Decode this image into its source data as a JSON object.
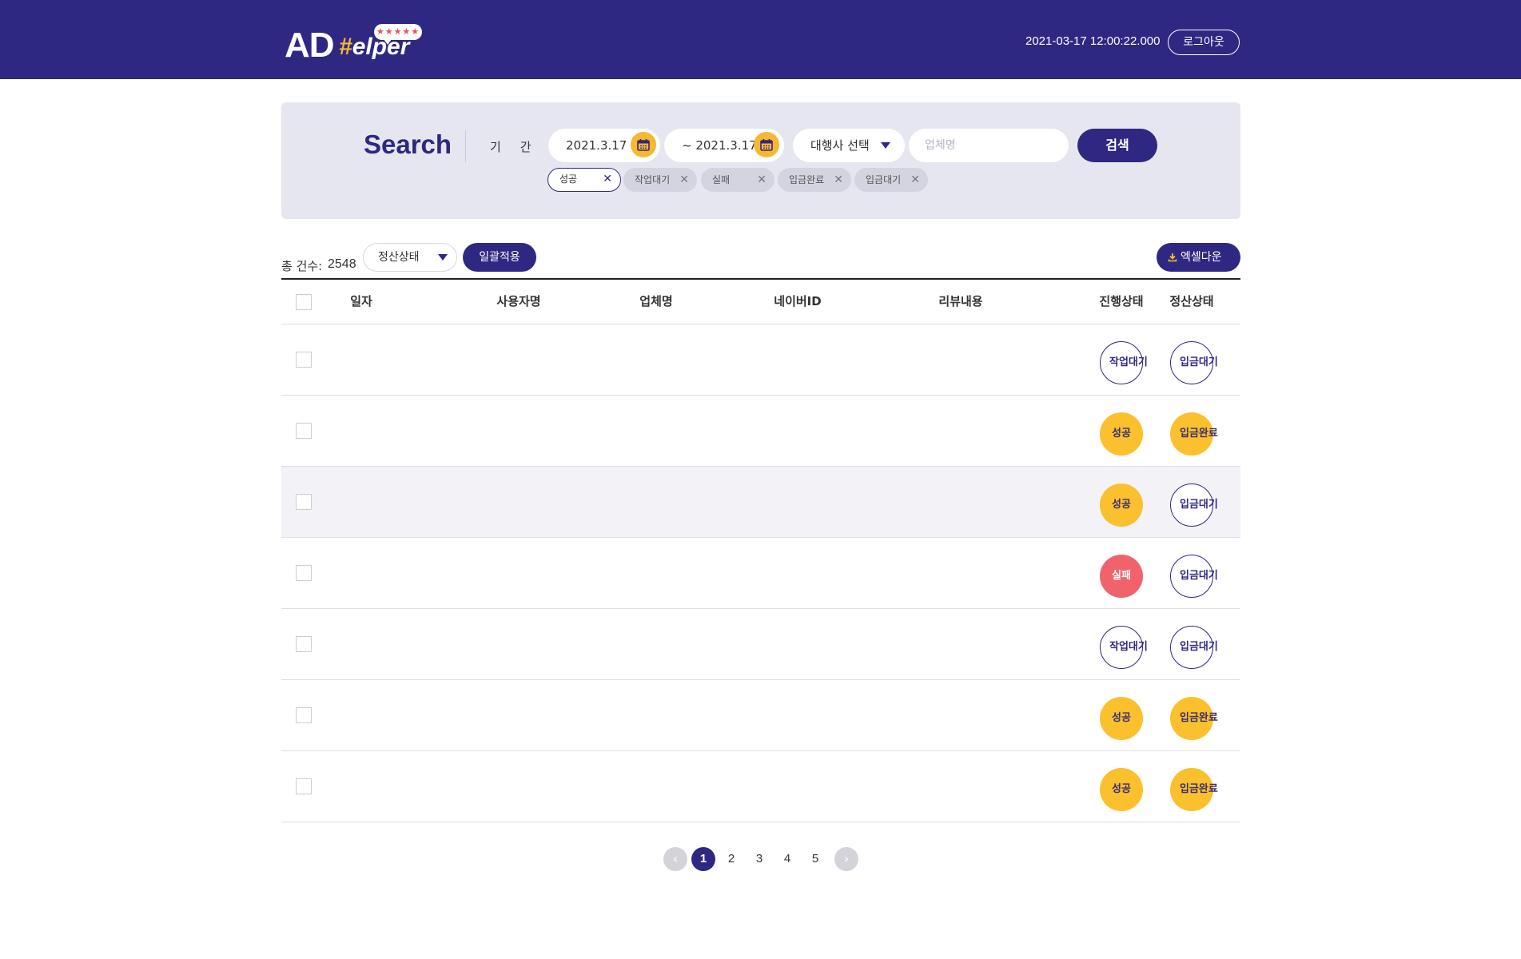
{
  "header": {
    "logo_text_ad": "AD",
    "logo_text_hash": "#",
    "logo_text_helper": "elper",
    "logo_stars": "★★★★★",
    "datetime": "2021-03-17 12:00:22.000",
    "logout_label": "로그아웃"
  },
  "search": {
    "title": "Search",
    "period_label": "기간",
    "date_start": "2021.3.17",
    "date_end": "~ 2021.3.17",
    "agency_select": "대행사 선택",
    "company_placeholder": "업체명",
    "search_label": "검색",
    "tags": [
      {
        "label": "성공",
        "active": true
      },
      {
        "label": "작업대기",
        "active": false
      },
      {
        "label": "실패",
        "active": false
      },
      {
        "label": "입금완료",
        "active": false
      },
      {
        "label": "입금대기",
        "active": false
      }
    ]
  },
  "toolbar": {
    "total_label": "총 건수:",
    "total_count": "2548",
    "status_select": "정산상태",
    "bulk_apply": "일괄적용",
    "excel_download": "엑셀다운"
  },
  "table": {
    "columns": [
      "일자",
      "사용자명",
      "업체명",
      "네이버ID",
      "리뷰내용",
      "진행상태",
      "정산상태"
    ],
    "rows": [
      {
        "progress": "작업대기",
        "progress_style": "outline",
        "settle": "입금대기",
        "settle_style": "outline"
      },
      {
        "progress": "성공",
        "progress_style": "yellow",
        "settle": "입금완료",
        "settle_style": "yellow"
      },
      {
        "progress": "성공",
        "progress_style": "yellow",
        "settle": "입금대기",
        "settle_style": "outline"
      },
      {
        "progress": "실패",
        "progress_style": "red",
        "settle": "입금대기",
        "settle_style": "outline"
      },
      {
        "progress": "작업대기",
        "progress_style": "outline",
        "settle": "입금대기",
        "settle_style": "outline"
      },
      {
        "progress": "성공",
        "progress_style": "yellow",
        "settle": "입금완료",
        "settle_style": "yellow"
      },
      {
        "progress": "성공",
        "progress_style": "yellow",
        "settle": "입금완료",
        "settle_style": "yellow"
      }
    ]
  },
  "pagination": {
    "prev_icon": "chevron-left-icon",
    "next_icon": "chevron-right-icon",
    "pages": [
      "1",
      "2",
      "3",
      "4",
      "5"
    ],
    "current": "1"
  },
  "colors": {
    "brand": "#2e2882",
    "accent_yellow": "#fbc02d",
    "danger": "#f1636b",
    "panel_bg": "#e6e6f0"
  }
}
